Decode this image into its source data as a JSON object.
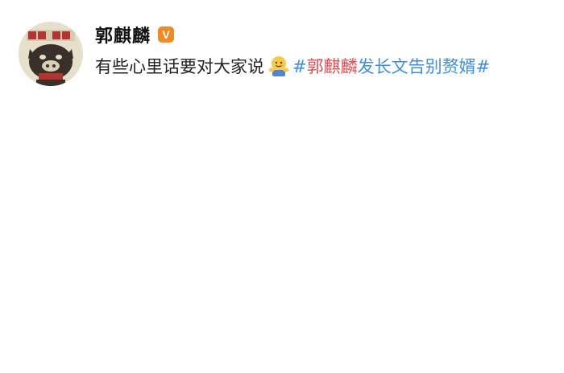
{
  "post": {
    "author": {
      "name": "郭麒麟",
      "verified_badge": "V",
      "avatar_icon": "pig-poster-avatar"
    },
    "text": "有些心里话要对大家说",
    "emoji": "hug-emoji",
    "hashtag": {
      "open": "#",
      "highlight": "郭麒麟",
      "rest": "发长文告别赘婿",
      "close": "#"
    },
    "colors": {
      "hashtag": "#3f8fdc",
      "highlight": "#e04b52",
      "badge": "#f08a24"
    }
  }
}
